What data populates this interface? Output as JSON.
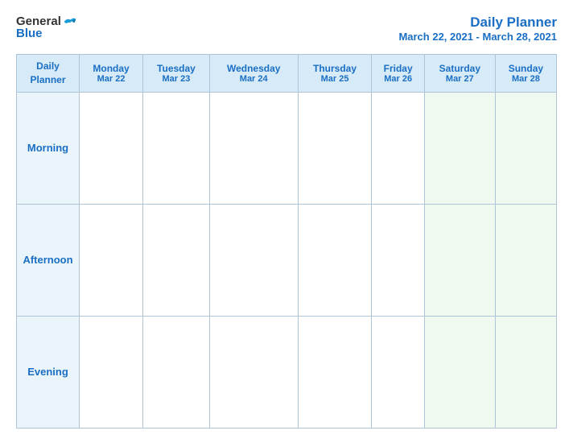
{
  "header": {
    "logo_general": "General",
    "logo_blue": "Blue",
    "title": "Daily Planner",
    "date_range": "March 22, 2021 - March 28, 2021"
  },
  "columns": [
    {
      "id": "label",
      "day": "Daily",
      "day2": "Planner",
      "date": ""
    },
    {
      "id": "mon",
      "day": "Monday",
      "date": "Mar 22"
    },
    {
      "id": "tue",
      "day": "Tuesday",
      "date": "Mar 23"
    },
    {
      "id": "wed",
      "day": "Wednesday",
      "date": "Mar 24"
    },
    {
      "id": "thu",
      "day": "Thursday",
      "date": "Mar 25"
    },
    {
      "id": "fri",
      "day": "Friday",
      "date": "Mar 26"
    },
    {
      "id": "sat",
      "day": "Saturday",
      "date": "Mar 27"
    },
    {
      "id": "sun",
      "day": "Sunday",
      "date": "Mar 28"
    }
  ],
  "rows": [
    {
      "id": "morning",
      "label": "Morning"
    },
    {
      "id": "afternoon",
      "label": "Afternoon"
    },
    {
      "id": "evening",
      "label": "Evening"
    }
  ]
}
